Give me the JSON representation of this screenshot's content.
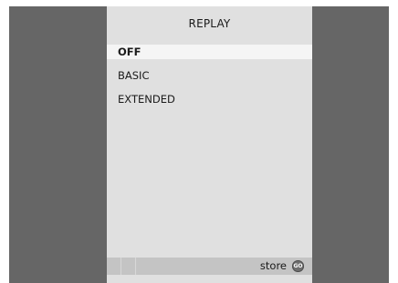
{
  "menu": {
    "title": "REPLAY",
    "items": [
      {
        "label": "OFF",
        "selected": true
      },
      {
        "label": "BASIC",
        "selected": false
      },
      {
        "label": "EXTENDED",
        "selected": false
      }
    ]
  },
  "footer": {
    "store_label": "store",
    "go_icon_text": "GO"
  },
  "colors": {
    "background_frame": "#666666",
    "panel": "#e0e0e0",
    "selected_row": "#f5f5f5",
    "footer_bar": "#c4c4c4"
  }
}
